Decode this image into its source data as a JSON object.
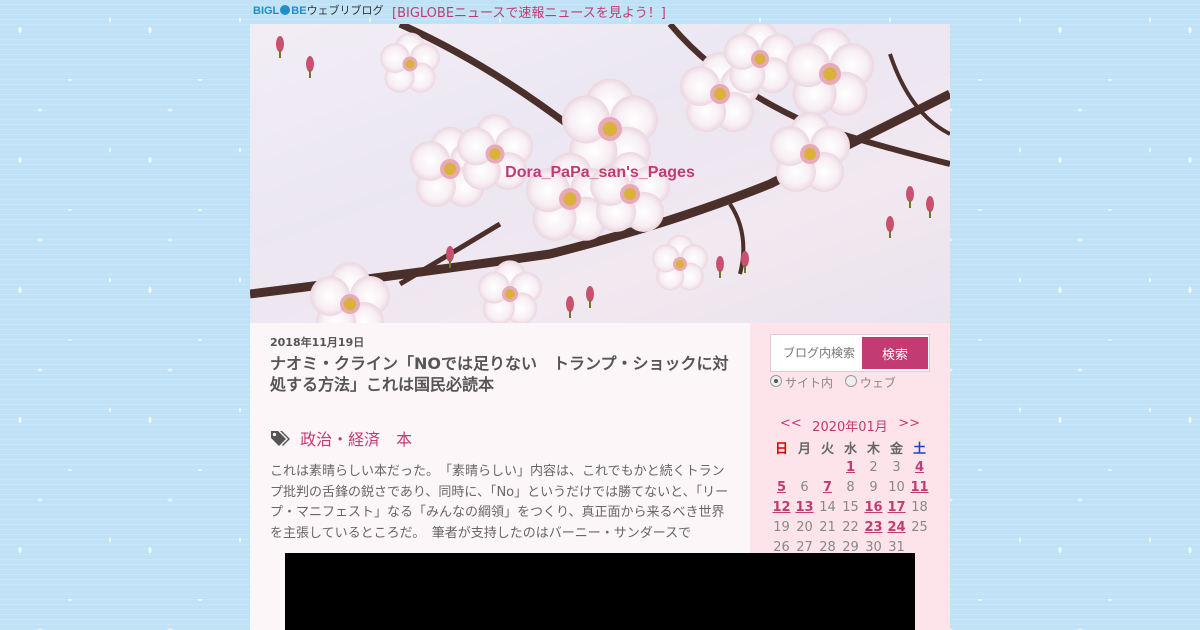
{
  "topbar": {
    "logo_text": "BIGLOBEウェブリブログ",
    "logo_part1": "BIGL",
    "logo_part2": "BE",
    "logo_part3": "ウェブリブログ",
    "news_link": "[BIGLOBEニュースで速報ニュースを見よう！]"
  },
  "header": {
    "site_title": "Dora_PaPa_san's_Pages"
  },
  "post": {
    "date": "2018年11月19日",
    "title": "ナオミ・クライン「NOでは足りない　トランプ・ショックに対処する方法」これは国民必読本",
    "tags": [
      "政治・経済",
      "本"
    ],
    "excerpt": "これは素晴らしい本だった。　「素晴らしい」内容は、これでもかと続くトランプ批判の舌鋒の鋭さであり、同時に、「No」というだけでは勝てないと、「リープ・マニフェスト」なる「みんなの綱領」をつくり、真正面から来るべき世界を主張しているところだ。　筆者が支持したのはバーニー・サンダースで"
  },
  "sidebar": {
    "search": {
      "placeholder": "ブログ内検索",
      "button_label": "検索",
      "options": [
        {
          "label": "サイト内",
          "selected": true
        },
        {
          "label": "ウェブ",
          "selected": false
        }
      ]
    },
    "calendar": {
      "prev": "<<",
      "month": "2020年01月",
      "next": ">>",
      "weekdays": [
        "日",
        "月",
        "火",
        "水",
        "木",
        "金",
        "土"
      ],
      "weeks": [
        [
          {
            "d": ""
          },
          {
            "d": ""
          },
          {
            "d": ""
          },
          {
            "d": "1",
            "link": true
          },
          {
            "d": "2"
          },
          {
            "d": "3"
          },
          {
            "d": "4",
            "link": true
          }
        ],
        [
          {
            "d": "5",
            "link": true
          },
          {
            "d": "6"
          },
          {
            "d": "7",
            "link": true
          },
          {
            "d": "8"
          },
          {
            "d": "9"
          },
          {
            "d": "10"
          },
          {
            "d": "11",
            "link": true
          }
        ],
        [
          {
            "d": "12",
            "link": true
          },
          {
            "d": "13",
            "link": true
          },
          {
            "d": "14"
          },
          {
            "d": "15"
          },
          {
            "d": "16",
            "link": true
          },
          {
            "d": "17",
            "link": true
          },
          {
            "d": "18"
          }
        ],
        [
          {
            "d": "19"
          },
          {
            "d": "20"
          },
          {
            "d": "21"
          },
          {
            "d": "22"
          },
          {
            "d": "23",
            "link": true
          },
          {
            "d": "24",
            "link": true
          },
          {
            "d": "25"
          }
        ],
        [
          {
            "d": "26"
          },
          {
            "d": "27"
          },
          {
            "d": "28"
          },
          {
            "d": "29"
          },
          {
            "d": "30"
          },
          {
            "d": "31"
          },
          {
            "d": ""
          }
        ]
      ]
    }
  },
  "colors": {
    "accent": "#c23b73",
    "sidebar_bg": "#fde4ea",
    "page_bg": "#bfe2f6",
    "sunday": "#dd0000",
    "saturday": "#1a44c8"
  },
  "icons": {
    "tag": "tags-icon",
    "logo_globe": "globe-icon"
  }
}
